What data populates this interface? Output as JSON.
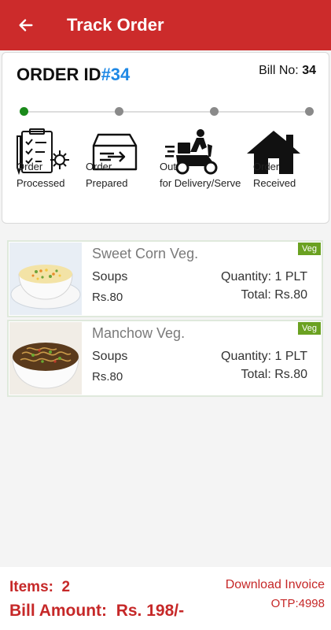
{
  "appbar": {
    "title": "Track Order"
  },
  "order": {
    "id_label": "ORDER ID",
    "id_number": "#34",
    "bill_label": "Bill No:",
    "bill_number": "34"
  },
  "steps": [
    {
      "line1": "Order",
      "line2": "Processed",
      "status": "done",
      "icon": "clipboard-gear-icon"
    },
    {
      "line1": "Order",
      "line2": "Prepared",
      "status": "pending",
      "icon": "box-arrow-icon"
    },
    {
      "line1": "Out",
      "line2": "for Delivery/Serve",
      "status": "pending",
      "icon": "scooter-rider-icon"
    },
    {
      "line1": "Order",
      "line2": "Received",
      "status": "pending",
      "icon": "house-icon"
    }
  ],
  "items": [
    {
      "name": "Sweet Corn Veg.",
      "category": "Soups",
      "price": "Rs.80",
      "quantity": "Quantity: 1 PLT",
      "total": "Total: Rs.80",
      "tag": "Veg",
      "image": "sweet-corn-soup-image"
    },
    {
      "name": "Manchow Veg.",
      "category": "Soups",
      "price": "Rs.80",
      "quantity": "Quantity: 1 PLT",
      "total": "Total: Rs.80",
      "tag": "Veg",
      "image": "manchow-soup-image"
    }
  ],
  "footer": {
    "items_label": "Items:",
    "items_count": "2",
    "bill_label": "Bill Amount:",
    "bill_amount": "Rs. 198/-",
    "download": "Download Invoice",
    "otp": "OTP:4998"
  },
  "colors": {
    "primary": "#cc2b2b",
    "order_id": "#1e88e5",
    "active_step": "#1a8a1a",
    "veg_tag": "#6aa121"
  }
}
